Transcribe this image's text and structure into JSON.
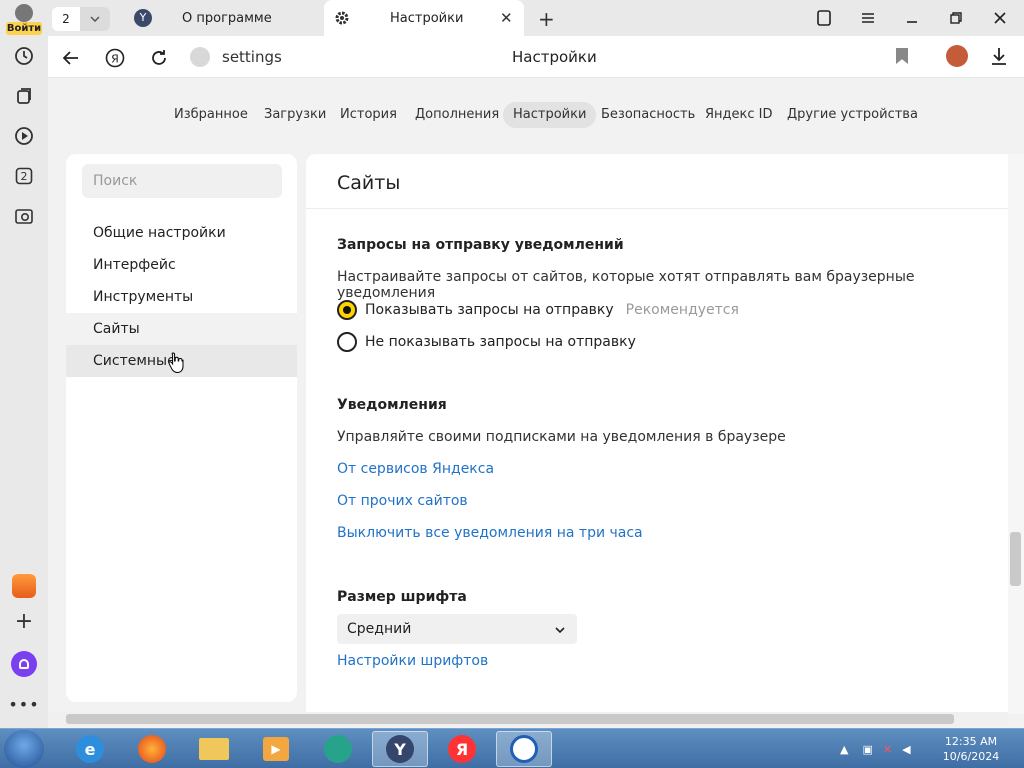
{
  "sidebar": {
    "login_label": "Войти",
    "tab_badge": "2"
  },
  "tabs": {
    "count": "2",
    "about_title": "О программе",
    "settings_title": "Настройки"
  },
  "addressbar": {
    "url": "settings",
    "title": "Настройки"
  },
  "topnav": {
    "items": [
      "Избранное",
      "Загрузки",
      "История",
      "Дополнения",
      "Настройки",
      "Безопасность",
      "Яндекс ID",
      "Другие устройства"
    ],
    "active": "Настройки"
  },
  "leftmenu": {
    "search_placeholder": "Поиск",
    "items": [
      "Общие настройки",
      "Интерфейс",
      "Инструменты",
      "Сайты",
      "Системные"
    ]
  },
  "content": {
    "title": "Сайты",
    "notif_requests": {
      "heading": "Запросы на отправку уведомлений",
      "desc": "Настраивайте запросы от сайтов, которые хотят отправлять вам браузерные уведомления",
      "option_show": "Показывать запросы на отправку",
      "option_show_hint": "Рекомендуется",
      "option_hide": "Не показывать запросы на отправку"
    },
    "notifications": {
      "heading": "Уведомления",
      "desc": "Управляйте своими подписками на уведомления в браузере",
      "link_yandex": "От сервисов Яндекса",
      "link_other": "От прочих сайтов",
      "link_mute": "Выключить все уведомления на три часа"
    },
    "font": {
      "heading": "Размер шрифта",
      "selected": "Средний",
      "link_settings": "Настройки шрифтов"
    }
  },
  "taskbar": {
    "time": "12:35 AM",
    "date": "10/6/2024"
  },
  "colors": {
    "accent_yellow": "#ffd400",
    "link_blue": "#2173c9"
  }
}
